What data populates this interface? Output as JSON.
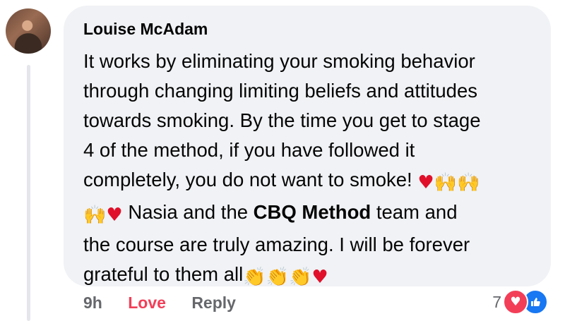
{
  "comment": {
    "author": "Louise McAdam",
    "lines": {
      "l1": "It works by eliminating your smoking behavior",
      "l2": "through changing limiting beliefs and attitudes",
      "l3": "towards smoking. By the time you get to stage",
      "l4": "4 of the method, if you have followed it",
      "l5": "completely, you do not want to smoke!",
      "l6a": " Nasia and the ",
      "l6bold": "CBQ Method",
      "l6b": " team and",
      "l7": "the course are truly amazing.  I will be forever",
      "l8": "grateful to them all"
    },
    "emoji": {
      "heart": "♥",
      "raised_hands": "🙌",
      "clap": "👏"
    }
  },
  "footer": {
    "time": "9h",
    "love_label": "Love",
    "reply_label": "Reply",
    "reaction_count": "7",
    "reaction_icons": [
      "heart-reaction-icon",
      "like-reaction-icon"
    ]
  },
  "colors": {
    "bubble": "#f0f2f5",
    "love": "#f33e58",
    "like": "#1877f2",
    "meta": "#65676b"
  }
}
